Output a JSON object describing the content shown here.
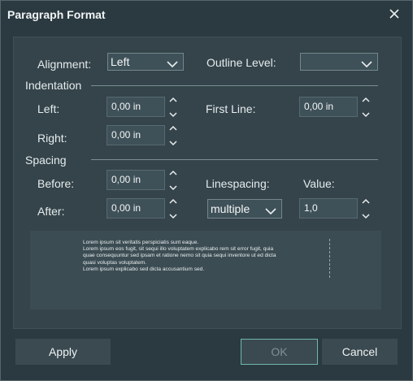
{
  "dialog": {
    "title": "Paragraph Format"
  },
  "alignment": {
    "label": "Alignment:",
    "value": "Left"
  },
  "outline_level": {
    "label": "Outline Level:",
    "value": ""
  },
  "indentation": {
    "heading": "Indentation",
    "left": {
      "label": "Left:",
      "value": "0,00 in"
    },
    "right": {
      "label": "Right:",
      "value": "0,00 in"
    },
    "first_line": {
      "label": "First Line:",
      "value": "0,00 in"
    }
  },
  "spacing": {
    "heading": "Spacing",
    "before": {
      "label": "Before:",
      "value": "0,00 in"
    },
    "after": {
      "label": "After:",
      "value": "0,00 in"
    },
    "linespacing": {
      "label": "Linespacing:",
      "value": "multiple"
    },
    "value": {
      "label": "Value:",
      "value": "1,0"
    }
  },
  "preview": {
    "lines": [
      "Lorem ipsum sit veritatis perspiciatis sunt eaque.",
      "Lorem ipsum eos fugit, sit sequi illo voluptatem explicabo rem sit error fugit, quia",
      "quae consequuntur sed ipsam et ratione nemo sit quia sequi inventore ut ed dicta",
      "quasi voluptas voluptatem.",
      "Lorem ipsum explicabo sed dicta accusantium sed."
    ]
  },
  "buttons": {
    "apply": "Apply",
    "ok": "OK",
    "cancel": "Cancel"
  },
  "colors": {
    "background": "#2b3a40",
    "panel": "#34444a",
    "accent": "#6fb6ad"
  }
}
